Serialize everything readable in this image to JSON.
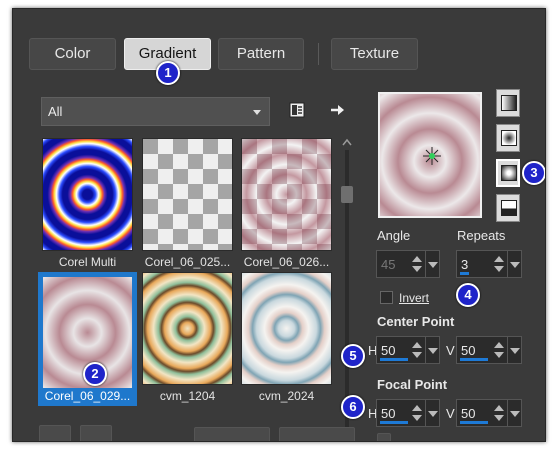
{
  "tabs": [
    {
      "label": "Color"
    },
    {
      "label": "Gradient"
    },
    {
      "label": "Pattern"
    },
    {
      "label": "Texture"
    }
  ],
  "filter": {
    "value": "All"
  },
  "icons": {
    "library": "gradient-library-icon",
    "forward": "arrow-right-icon"
  },
  "thumbnails": [
    {
      "label": "Corel Multi"
    },
    {
      "label": "Corel_06_025..."
    },
    {
      "label": "Corel_06_026..."
    },
    {
      "label": "Corel_06_029...",
      "selected": true
    },
    {
      "label": "cvm_1204"
    },
    {
      "label": "cvm_2024"
    }
  ],
  "controls": {
    "angle_label": "Angle",
    "angle_value": "45",
    "repeats_label": "Repeats",
    "repeats_value": "3",
    "invert_label": "Invert",
    "center_point_label": "Center Point",
    "center_h_label": "H",
    "center_h_value": "50",
    "center_v_label": "V",
    "center_v_value": "50",
    "focal_point_label": "Focal Point",
    "focal_h_label": "H",
    "focal_h_value": "50",
    "focal_v_label": "V",
    "focal_v_value": "50"
  },
  "badges": [
    "1",
    "2",
    "3",
    "4",
    "5",
    "6"
  ],
  "colors": {
    "selection": "#1f78cc",
    "badge": "#1f24c9",
    "panel": "#3a3a3a"
  }
}
